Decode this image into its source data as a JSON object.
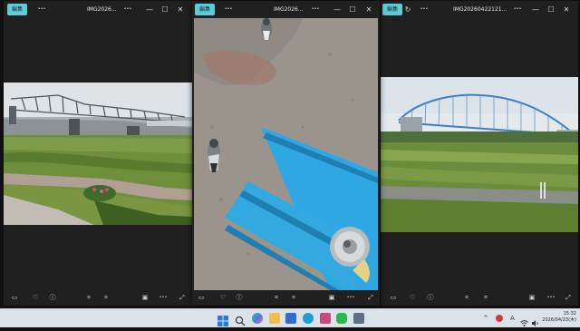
{
  "windows": [
    {
      "edit_label": "編集",
      "filename": "IMG2026..."
    },
    {
      "edit_label": "編集",
      "filename": "IMG2026..."
    },
    {
      "edit_label": "編集",
      "filename": "IMG20260422121..."
    }
  ],
  "icons": {
    "more": "•••",
    "minimize": "—",
    "maximize": "☐",
    "close": "✕",
    "screen": "▭",
    "heart": "♡",
    "info": "ⓘ",
    "crop": "⌗",
    "slideshow": "▣",
    "fullscreen": "⤢",
    "rotate": "↻"
  },
  "photos": [
    {
      "subject": "bridge over river with park"
    },
    {
      "subject": "pigeons and blue bench with can"
    },
    {
      "subject": "blue arch bridge over river"
    }
  ],
  "taskbar": {
    "tray_chevron": "^",
    "ime": "A",
    "time": "15:32",
    "date": "2026/04/23(木)"
  }
}
